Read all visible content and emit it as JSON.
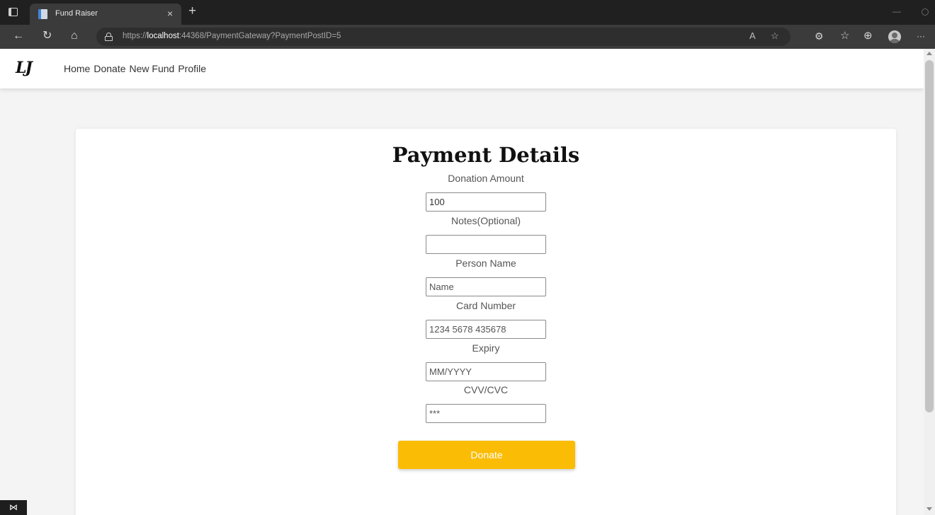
{
  "browser": {
    "tab_title": "Fund Raiser",
    "tab_close": "×",
    "new_tab": "+",
    "url_prefix": "https://",
    "url_host": "localhost",
    "url_rest": ":44368/PaymentGateway?PaymentPostID=5",
    "icons": {
      "back": "←",
      "refresh": "↻",
      "home": "⌂",
      "read_aloud": "A",
      "favorite_add": "☆",
      "extensions": "⚙",
      "favorites": "☆",
      "collections": "⊕",
      "more": "···",
      "minimize": "—"
    }
  },
  "site": {
    "logo": "LJ",
    "nav": [
      "Home",
      "Donate",
      "New Fund",
      "Profile"
    ]
  },
  "form": {
    "title": "Payment Details",
    "fields": [
      {
        "label": "Donation Amount",
        "value": "100",
        "placeholder": ""
      },
      {
        "label": "Notes(Optional)",
        "value": "",
        "placeholder": ""
      },
      {
        "label": "Person Name",
        "value": "",
        "placeholder": "Name"
      },
      {
        "label": "Card Number",
        "value": "",
        "placeholder": "1234 5678 435678"
      },
      {
        "label": "Expiry",
        "value": "",
        "placeholder": "MM/YYYY"
      },
      {
        "label": "CVV/CVC",
        "value": "",
        "placeholder": "***"
      }
    ],
    "submit_label": "Donate"
  },
  "taskbar_badge": "⋈",
  "colors": {
    "accent": "#fbbc05",
    "chrome_dark": "#202020",
    "chrome_toolbar": "#3b3b3b"
  }
}
